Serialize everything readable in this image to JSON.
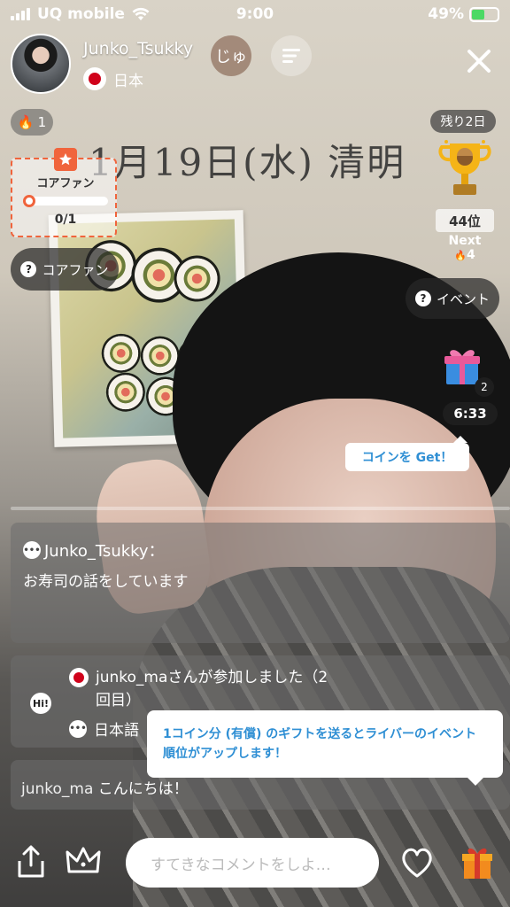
{
  "status_bar": {
    "carrier": "UQ mobile",
    "time": "9:00",
    "battery": "49%"
  },
  "liver": {
    "name": "Junko_Tsukky",
    "country": "日本",
    "ju_label": "じゅ"
  },
  "fire_count": "1",
  "core_fan": {
    "title": "コアファン",
    "progress": "0/1",
    "button_label": "コアファン"
  },
  "event_panel": {
    "days_left": "残り2日",
    "rank": "44位",
    "next_label": "Next",
    "next_value": "4",
    "event_button": "イベント",
    "gift_count": "2",
    "timer": "6:33",
    "coin_tooltip": "コインを Get！"
  },
  "background_text": "1月19日(水) 清明",
  "chat": {
    "msg1_name": "Junko_Tsukky：",
    "msg1_text": "お寿司の話をしています",
    "hi_label": "Hi!",
    "msg2_line1": "junko_maさんが参加しました（2",
    "msg2_line1b": "回目）",
    "msg2_line2": "日本語",
    "msg3_user": "junko_ma",
    "msg3_text": "こんにちは！"
  },
  "rank_tooltip": "1コイン分 (有償) のギフトを送るとライバーのイベント順位がアップします！",
  "comment_placeholder": "すてきなコメントをしよ…",
  "colors": {
    "accent_orange": "#f0643c",
    "tooltip_blue": "#2f8fd4",
    "battery_green": "#4cd964"
  }
}
